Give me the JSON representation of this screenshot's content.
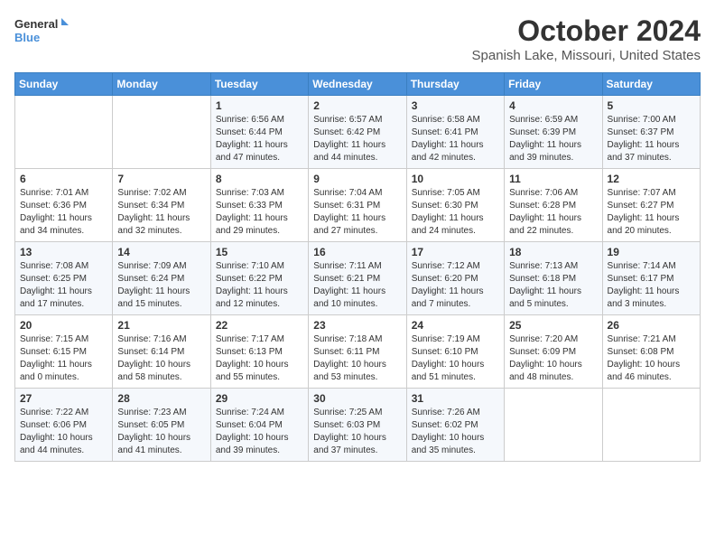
{
  "header": {
    "logo_line1": "General",
    "logo_line2": "Blue",
    "month": "October 2024",
    "location": "Spanish Lake, Missouri, United States"
  },
  "days_of_week": [
    "Sunday",
    "Monday",
    "Tuesday",
    "Wednesday",
    "Thursday",
    "Friday",
    "Saturday"
  ],
  "weeks": [
    [
      {
        "day": "",
        "info": ""
      },
      {
        "day": "",
        "info": ""
      },
      {
        "day": "1",
        "info": "Sunrise: 6:56 AM\nSunset: 6:44 PM\nDaylight: 11 hours and 47 minutes."
      },
      {
        "day": "2",
        "info": "Sunrise: 6:57 AM\nSunset: 6:42 PM\nDaylight: 11 hours and 44 minutes."
      },
      {
        "day": "3",
        "info": "Sunrise: 6:58 AM\nSunset: 6:41 PM\nDaylight: 11 hours and 42 minutes."
      },
      {
        "day": "4",
        "info": "Sunrise: 6:59 AM\nSunset: 6:39 PM\nDaylight: 11 hours and 39 minutes."
      },
      {
        "day": "5",
        "info": "Sunrise: 7:00 AM\nSunset: 6:37 PM\nDaylight: 11 hours and 37 minutes."
      }
    ],
    [
      {
        "day": "6",
        "info": "Sunrise: 7:01 AM\nSunset: 6:36 PM\nDaylight: 11 hours and 34 minutes."
      },
      {
        "day": "7",
        "info": "Sunrise: 7:02 AM\nSunset: 6:34 PM\nDaylight: 11 hours and 32 minutes."
      },
      {
        "day": "8",
        "info": "Sunrise: 7:03 AM\nSunset: 6:33 PM\nDaylight: 11 hours and 29 minutes."
      },
      {
        "day": "9",
        "info": "Sunrise: 7:04 AM\nSunset: 6:31 PM\nDaylight: 11 hours and 27 minutes."
      },
      {
        "day": "10",
        "info": "Sunrise: 7:05 AM\nSunset: 6:30 PM\nDaylight: 11 hours and 24 minutes."
      },
      {
        "day": "11",
        "info": "Sunrise: 7:06 AM\nSunset: 6:28 PM\nDaylight: 11 hours and 22 minutes."
      },
      {
        "day": "12",
        "info": "Sunrise: 7:07 AM\nSunset: 6:27 PM\nDaylight: 11 hours and 20 minutes."
      }
    ],
    [
      {
        "day": "13",
        "info": "Sunrise: 7:08 AM\nSunset: 6:25 PM\nDaylight: 11 hours and 17 minutes."
      },
      {
        "day": "14",
        "info": "Sunrise: 7:09 AM\nSunset: 6:24 PM\nDaylight: 11 hours and 15 minutes."
      },
      {
        "day": "15",
        "info": "Sunrise: 7:10 AM\nSunset: 6:22 PM\nDaylight: 11 hours and 12 minutes."
      },
      {
        "day": "16",
        "info": "Sunrise: 7:11 AM\nSunset: 6:21 PM\nDaylight: 11 hours and 10 minutes."
      },
      {
        "day": "17",
        "info": "Sunrise: 7:12 AM\nSunset: 6:20 PM\nDaylight: 11 hours and 7 minutes."
      },
      {
        "day": "18",
        "info": "Sunrise: 7:13 AM\nSunset: 6:18 PM\nDaylight: 11 hours and 5 minutes."
      },
      {
        "day": "19",
        "info": "Sunrise: 7:14 AM\nSunset: 6:17 PM\nDaylight: 11 hours and 3 minutes."
      }
    ],
    [
      {
        "day": "20",
        "info": "Sunrise: 7:15 AM\nSunset: 6:15 PM\nDaylight: 11 hours and 0 minutes."
      },
      {
        "day": "21",
        "info": "Sunrise: 7:16 AM\nSunset: 6:14 PM\nDaylight: 10 hours and 58 minutes."
      },
      {
        "day": "22",
        "info": "Sunrise: 7:17 AM\nSunset: 6:13 PM\nDaylight: 10 hours and 55 minutes."
      },
      {
        "day": "23",
        "info": "Sunrise: 7:18 AM\nSunset: 6:11 PM\nDaylight: 10 hours and 53 minutes."
      },
      {
        "day": "24",
        "info": "Sunrise: 7:19 AM\nSunset: 6:10 PM\nDaylight: 10 hours and 51 minutes."
      },
      {
        "day": "25",
        "info": "Sunrise: 7:20 AM\nSunset: 6:09 PM\nDaylight: 10 hours and 48 minutes."
      },
      {
        "day": "26",
        "info": "Sunrise: 7:21 AM\nSunset: 6:08 PM\nDaylight: 10 hours and 46 minutes."
      }
    ],
    [
      {
        "day": "27",
        "info": "Sunrise: 7:22 AM\nSunset: 6:06 PM\nDaylight: 10 hours and 44 minutes."
      },
      {
        "day": "28",
        "info": "Sunrise: 7:23 AM\nSunset: 6:05 PM\nDaylight: 10 hours and 41 minutes."
      },
      {
        "day": "29",
        "info": "Sunrise: 7:24 AM\nSunset: 6:04 PM\nDaylight: 10 hours and 39 minutes."
      },
      {
        "day": "30",
        "info": "Sunrise: 7:25 AM\nSunset: 6:03 PM\nDaylight: 10 hours and 37 minutes."
      },
      {
        "day": "31",
        "info": "Sunrise: 7:26 AM\nSunset: 6:02 PM\nDaylight: 10 hours and 35 minutes."
      },
      {
        "day": "",
        "info": ""
      },
      {
        "day": "",
        "info": ""
      }
    ]
  ]
}
